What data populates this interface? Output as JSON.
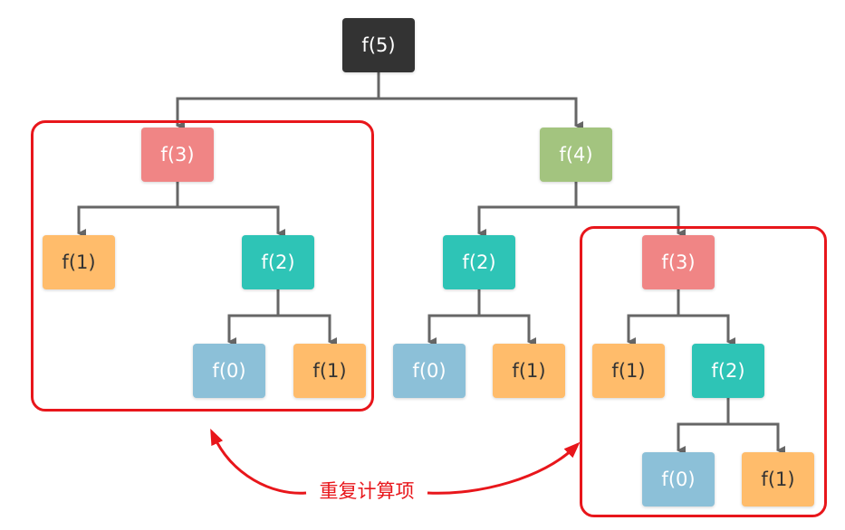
{
  "colors": {
    "root": "#333333",
    "f4": "#a3c47f",
    "f3": "#f08585",
    "f2": "#2ec4b6",
    "f1": "#ffbc6b",
    "f0": "#8cc0d8",
    "arrow": "#666666",
    "highlight": "#e8161b",
    "text_dark": "#333333",
    "text_light": "#ffffff"
  },
  "nodes": [
    {
      "id": "n-f5",
      "label": "f(5)",
      "kind": "root"
    },
    {
      "id": "n-f3-left",
      "label": "f(3)",
      "kind": "f3"
    },
    {
      "id": "n-f4",
      "label": "f(4)",
      "kind": "f4"
    },
    {
      "id": "n-f1-a",
      "label": "f(1)",
      "kind": "f1"
    },
    {
      "id": "n-f2-a",
      "label": "f(2)",
      "kind": "f2"
    },
    {
      "id": "n-f0-a",
      "label": "f(0)",
      "kind": "f0"
    },
    {
      "id": "n-f1-b",
      "label": "f(1)",
      "kind": "f1"
    },
    {
      "id": "n-f2-b",
      "label": "f(2)",
      "kind": "f2"
    },
    {
      "id": "n-f3-right",
      "label": "f(3)",
      "kind": "f3"
    },
    {
      "id": "n-f0-b",
      "label": "f(0)",
      "kind": "f0"
    },
    {
      "id": "n-f1-c",
      "label": "f(1)",
      "kind": "f1"
    },
    {
      "id": "n-f1-d",
      "label": "f(1)",
      "kind": "f1"
    },
    {
      "id": "n-f2-c",
      "label": "f(2)",
      "kind": "f2"
    },
    {
      "id": "n-f0-c",
      "label": "f(0)",
      "kind": "f0"
    },
    {
      "id": "n-f1-e",
      "label": "f(1)",
      "kind": "f1"
    }
  ],
  "edges": [
    [
      "n-f5",
      "n-f3-left"
    ],
    [
      "n-f5",
      "n-f4"
    ],
    [
      "n-f3-left",
      "n-f1-a"
    ],
    [
      "n-f3-left",
      "n-f2-a"
    ],
    [
      "n-f2-a",
      "n-f0-a"
    ],
    [
      "n-f2-a",
      "n-f1-b"
    ],
    [
      "n-f4",
      "n-f2-b"
    ],
    [
      "n-f4",
      "n-f3-right"
    ],
    [
      "n-f2-b",
      "n-f0-b"
    ],
    [
      "n-f2-b",
      "n-f1-c"
    ],
    [
      "n-f3-right",
      "n-f1-d"
    ],
    [
      "n-f3-right",
      "n-f2-c"
    ],
    [
      "n-f2-c",
      "n-f0-c"
    ],
    [
      "n-f2-c",
      "n-f1-e"
    ]
  ],
  "caption": "重复计算项"
}
